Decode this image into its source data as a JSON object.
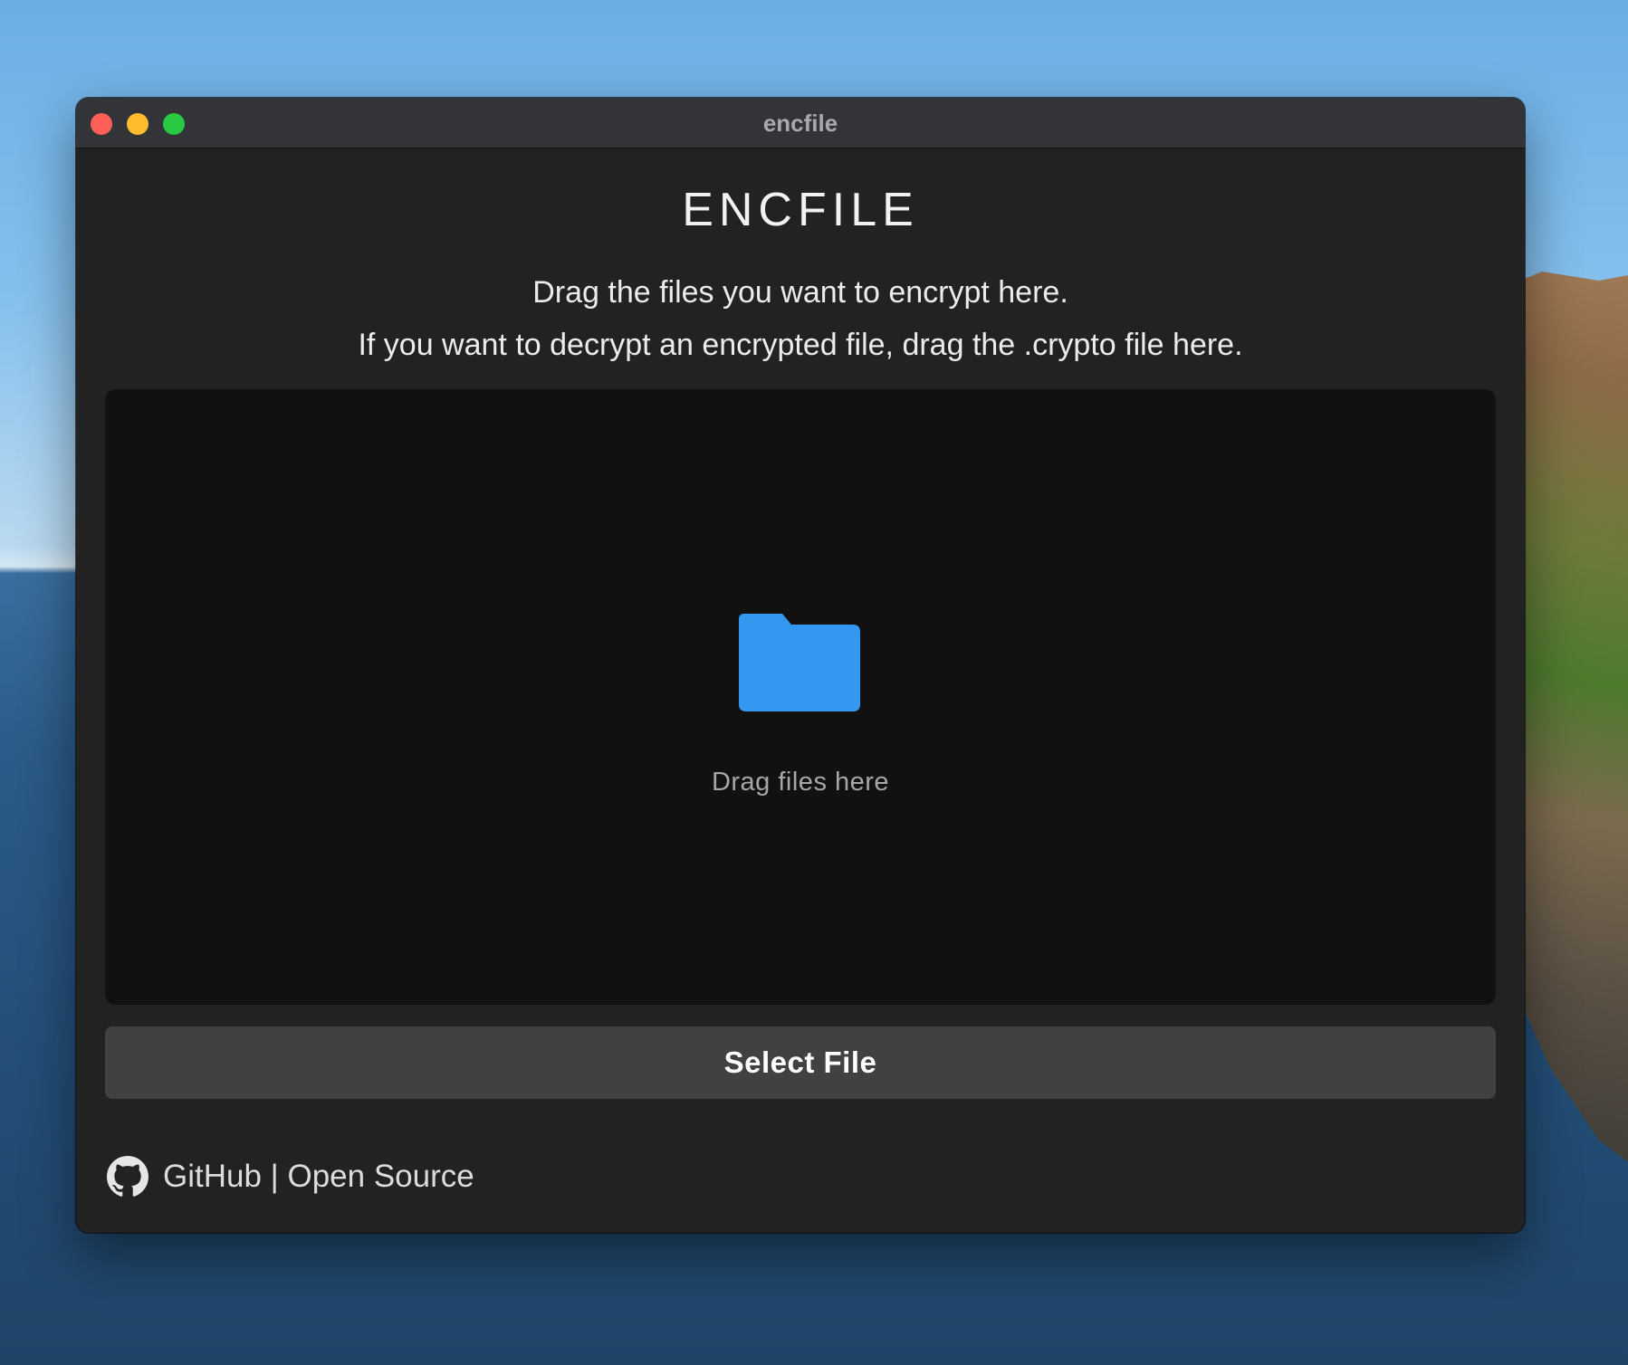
{
  "window": {
    "title": "encfile"
  },
  "app": {
    "heading": "ENCFILE",
    "instruction_encrypt": "Drag the files you want to encrypt here.",
    "instruction_decrypt": "If you want to decrypt an encrypted file, drag the .crypto file here."
  },
  "dropzone": {
    "icon": "folder-icon",
    "label": "Drag files here"
  },
  "actions": {
    "select_file_label": "Select File"
  },
  "footer": {
    "icon": "github-icon",
    "link_text": "GitHub | Open Source"
  },
  "colors": {
    "accent_folder": "#3498f0",
    "window_bg": "#222223",
    "dropzone_bg": "#111112",
    "button_bg": "#414142",
    "traffic_close": "#fe5f57",
    "traffic_minimize": "#febc2e",
    "traffic_maximize": "#28c840"
  }
}
